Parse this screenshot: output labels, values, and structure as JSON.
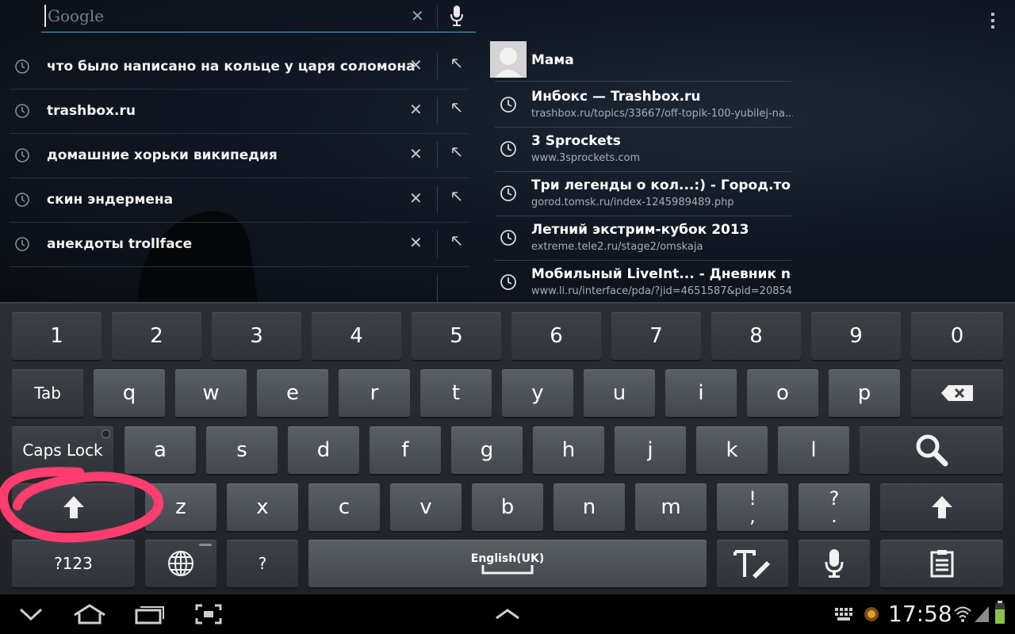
{
  "search": {
    "placeholder": "Google",
    "value": ""
  },
  "suggestions": [
    {
      "text": "что было написано на кольце у царя соломона"
    },
    {
      "text": "trashbox.ru"
    },
    {
      "text": "домашние хорьки википедия"
    },
    {
      "text": "скин эндермена"
    },
    {
      "text": "анекдоты trollface"
    }
  ],
  "contact": {
    "name": "Мама"
  },
  "history": [
    {
      "title": "Инбокс — Trashbox.ru",
      "url": "trashbox.ru/topics/33667/off-topik-100-yubilej-na..."
    },
    {
      "title": "3 Sprockets",
      "url": "www.3sprockets.com"
    },
    {
      "title": "Три легенды о кол...:) - Город.томск.ру",
      "url": "gorod.tomsk.ru/index-1245989489.php"
    },
    {
      "title": "Летний экстрим-кубок 2013",
      "url": "extreme.tele2.ru/stage2/omskaja"
    },
    {
      "title": "Мобильный LiveInt... - Дневник netalla |",
      "url": "www.li.ru/interface/pda/?jid=4651587&pid=20854"
    }
  ],
  "keyboard": {
    "row_numbers": [
      "1",
      "2",
      "3",
      "4",
      "5",
      "6",
      "7",
      "8",
      "9",
      "0"
    ],
    "row_q": [
      "q",
      "w",
      "e",
      "r",
      "t",
      "y",
      "u",
      "i",
      "o",
      "p"
    ],
    "row_a": [
      "a",
      "s",
      "d",
      "f",
      "g",
      "h",
      "j",
      "k",
      "l"
    ],
    "row_z": [
      "z",
      "x",
      "c",
      "v",
      "b",
      "n",
      "m"
    ],
    "tab_label": "Tab",
    "caps_label": "Caps Lock",
    "excl_top": "!",
    "excl_bottom": ",",
    "quest_top": "?",
    "quest_bottom": ".",
    "symbols_label": "?123",
    "question_label": "?",
    "space_label": "English(UK)"
  },
  "statusbar": {
    "time": "17:58"
  },
  "colors": {
    "accent": "#33b5e5",
    "annotation_circle": "#ff3d6e"
  }
}
